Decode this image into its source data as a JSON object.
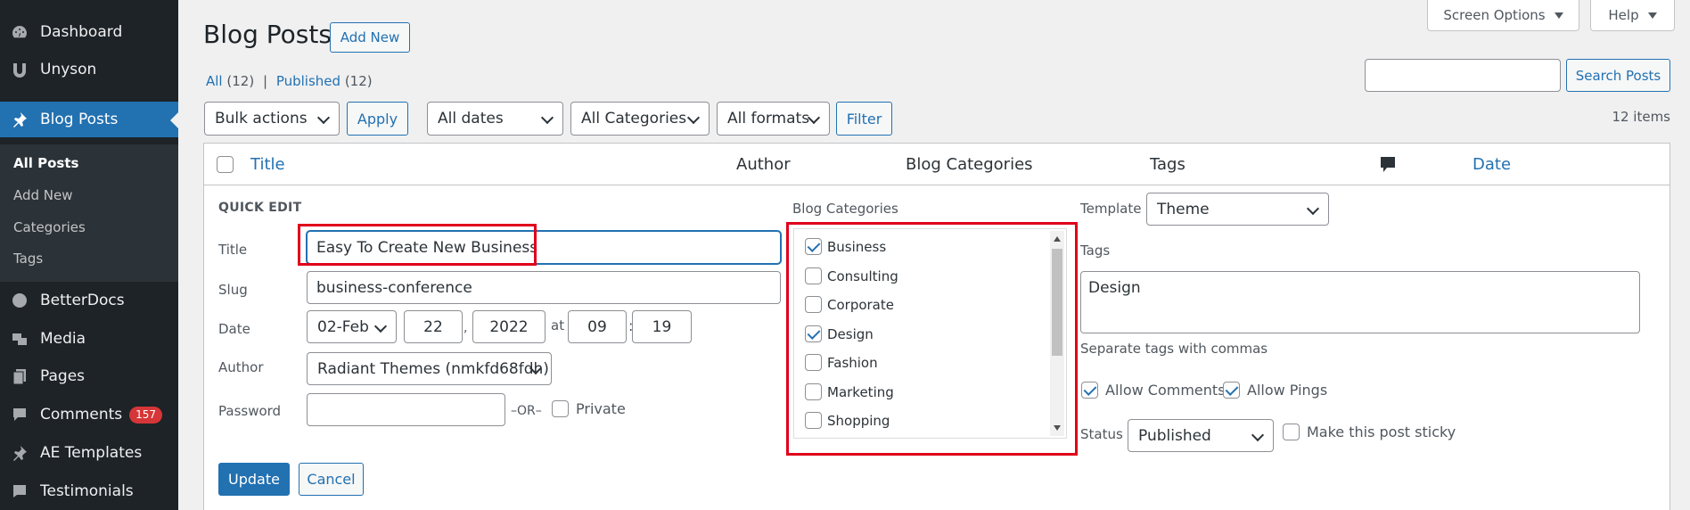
{
  "sidebar": {
    "items": [
      {
        "label": "Dashboard",
        "icon": "dashboard-icon"
      },
      {
        "label": "Unyson",
        "icon": "unyson-icon"
      },
      {
        "label": "Blog Posts",
        "icon": "pin-icon"
      },
      {
        "label": "BetterDocs",
        "icon": "docs-icon"
      },
      {
        "label": "Media",
        "icon": "media-icon"
      },
      {
        "label": "Pages",
        "icon": "pages-icon"
      },
      {
        "label": "Comments",
        "icon": "comments-icon",
        "badge": "157"
      },
      {
        "label": "AE Templates",
        "icon": "pin-icon"
      },
      {
        "label": "Testimonials",
        "icon": "testimonial-icon"
      }
    ],
    "submenu": [
      "All Posts",
      "Add New",
      "Categories",
      "Tags"
    ]
  },
  "header": {
    "screen_options": "Screen Options",
    "help": "Help",
    "title": "Blog Posts",
    "add_new": "Add New"
  },
  "views": {
    "all": "All",
    "all_count": "(12)",
    "separator": "|",
    "published": "Published",
    "published_count": "(12)"
  },
  "search": {
    "value": "",
    "button": "Search Posts"
  },
  "filters": {
    "bulk": "Bulk actions",
    "apply": "Apply",
    "dates": "All dates",
    "categories": "All Categories",
    "formats": "All formats",
    "filter": "Filter",
    "items_count": "12 items"
  },
  "table": {
    "headers": {
      "title": "Title",
      "author": "Author",
      "categories": "Blog Categories",
      "tags": "Tags",
      "date": "Date"
    }
  },
  "quick_edit": {
    "heading": "QUICK EDIT",
    "title_label": "Title",
    "title_value": "Easy To Create New Business",
    "slug_label": "Slug",
    "slug_value": "business-conference",
    "date_label": "Date",
    "month": "02-Feb",
    "day": "22",
    "year": "2022",
    "at": "at",
    "hour": "09",
    "minute": "19",
    "author_label": "Author",
    "author_value": "Radiant Themes (nmkfd68fdh)",
    "password_label": "Password",
    "password_value": "",
    "or": "–OR–",
    "private": "Private",
    "update": "Update",
    "cancel": "Cancel",
    "categories_label": "Blog Categories",
    "categories": [
      {
        "name": "Business",
        "checked": true
      },
      {
        "name": "Consulting",
        "checked": false
      },
      {
        "name": "Corporate",
        "checked": false
      },
      {
        "name": "Design",
        "checked": true
      },
      {
        "name": "Fashion",
        "checked": false
      },
      {
        "name": "Marketing",
        "checked": false
      },
      {
        "name": "Shopping",
        "checked": false
      }
    ],
    "template_label": "Template",
    "template_value": "Theme",
    "tags_label": "Tags",
    "tags_value": "Design",
    "tags_hint": "Separate tags with commas",
    "allow_comments": "Allow Comments",
    "allow_pings": "Allow Pings",
    "status_label": "Status",
    "status_value": "Published",
    "sticky": "Make this post sticky"
  },
  "colors": {
    "accent": "#2271b1",
    "sidebar": "#1d2327",
    "highlight": "#e0001a"
  }
}
